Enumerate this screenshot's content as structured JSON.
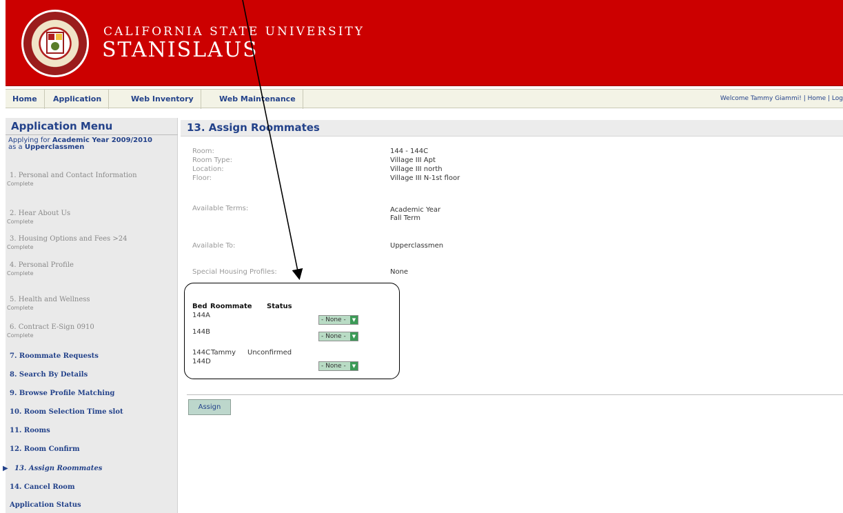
{
  "header": {
    "university_top": "CALIFORNIA STATE UNIVERSITY",
    "university_main": "STANISLAUS"
  },
  "nav": {
    "items": [
      "Home",
      "Application",
      "Web Inventory",
      "Web Maintenance"
    ],
    "welcome": "Welcome Tammy Giammi! | Home | Log"
  },
  "sidebar": {
    "title": "Application Menu",
    "applying_prefix": "Applying for",
    "term": "Academic Year 2009/2010",
    "as_prefix": "as a",
    "classification": "Upperclassmen",
    "steps": [
      {
        "label": "1. Personal and Contact Information",
        "status": "Complete"
      },
      {
        "label": "2. Hear About Us",
        "status": "Complete"
      },
      {
        "label": "3. Housing Options and Fees >24",
        "status": "Complete"
      },
      {
        "label": "4. Personal Profile",
        "status": "Complete"
      },
      {
        "label": "5. Health and Wellness",
        "status": "Complete"
      },
      {
        "label": "6. Contract E-Sign 0910",
        "status": "Complete"
      },
      {
        "label": "7. Roommate Requests"
      },
      {
        "label": "8. Search By Details"
      },
      {
        "label": "9. Browse Profile Matching"
      },
      {
        "label": "10. Room Selection Time slot"
      },
      {
        "label": "11. Rooms"
      },
      {
        "label": "12. Room Confirm"
      },
      {
        "label": "13. Assign Roommates"
      },
      {
        "label": "14. Cancel Room"
      },
      {
        "label": "Application Status"
      }
    ]
  },
  "main": {
    "title": "13. Assign Roommates",
    "room_label": "Room:",
    "room_value": "144 - 144C",
    "room_type_label": "Room Type:",
    "room_type_value": "Village III Apt",
    "location_label": "Location:",
    "location_value": "Village III north",
    "floor_label": "Floor:",
    "floor_value": "Village III N-1st floor",
    "available_terms_label": "Available Terms:",
    "available_terms": [
      "Academic Year",
      "Fall Term"
    ],
    "available_to_label": "Available To:",
    "available_to_value": "Upperclassmen",
    "special_label": "Special Housing Profiles:",
    "special_value": "None",
    "table_headers": [
      "Bed",
      "Roommate",
      "Status"
    ],
    "rows": [
      {
        "bed": "144A",
        "roommate": "",
        "status": "",
        "select": "- None -"
      },
      {
        "bed": "144B",
        "roommate": "",
        "status": "",
        "select": "- None -"
      },
      {
        "bed": "144C",
        "roommate": "Tammy",
        "status": "Unconfirmed",
        "select": ""
      },
      {
        "bed": "144D",
        "roommate": "",
        "status": "",
        "select": "- None -"
      }
    ],
    "assign_label": "Assign"
  }
}
